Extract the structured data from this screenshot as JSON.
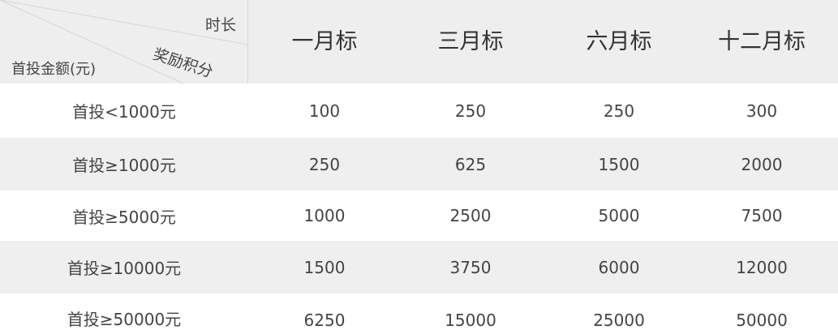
{
  "corner": {
    "duration_label": "时长",
    "points_label": "奖励积分",
    "amount_label": "首投金额(元)"
  },
  "columns": [
    "一月标",
    "三月标",
    "六月标",
    "十二月标"
  ],
  "rows": [
    {
      "label": "首投<1000元",
      "values": [
        "100",
        "250",
        "250",
        "300"
      ]
    },
    {
      "label": "首投≥1000元",
      "values": [
        "250",
        "625",
        "1500",
        "2000"
      ]
    },
    {
      "label": "首投≥5000元",
      "values": [
        "1000",
        "2500",
        "5000",
        "7500"
      ]
    },
    {
      "label": "首投≥10000元",
      "values": [
        "1500",
        "3750",
        "6000",
        "12000"
      ]
    },
    {
      "label": "首投≥50000元",
      "values": [
        "6250",
        "15000",
        "25000",
        "50000"
      ]
    }
  ],
  "colors": {
    "header_bg": "#eeeeee",
    "alt_row_bg": "#efefef",
    "text": "#444444"
  }
}
